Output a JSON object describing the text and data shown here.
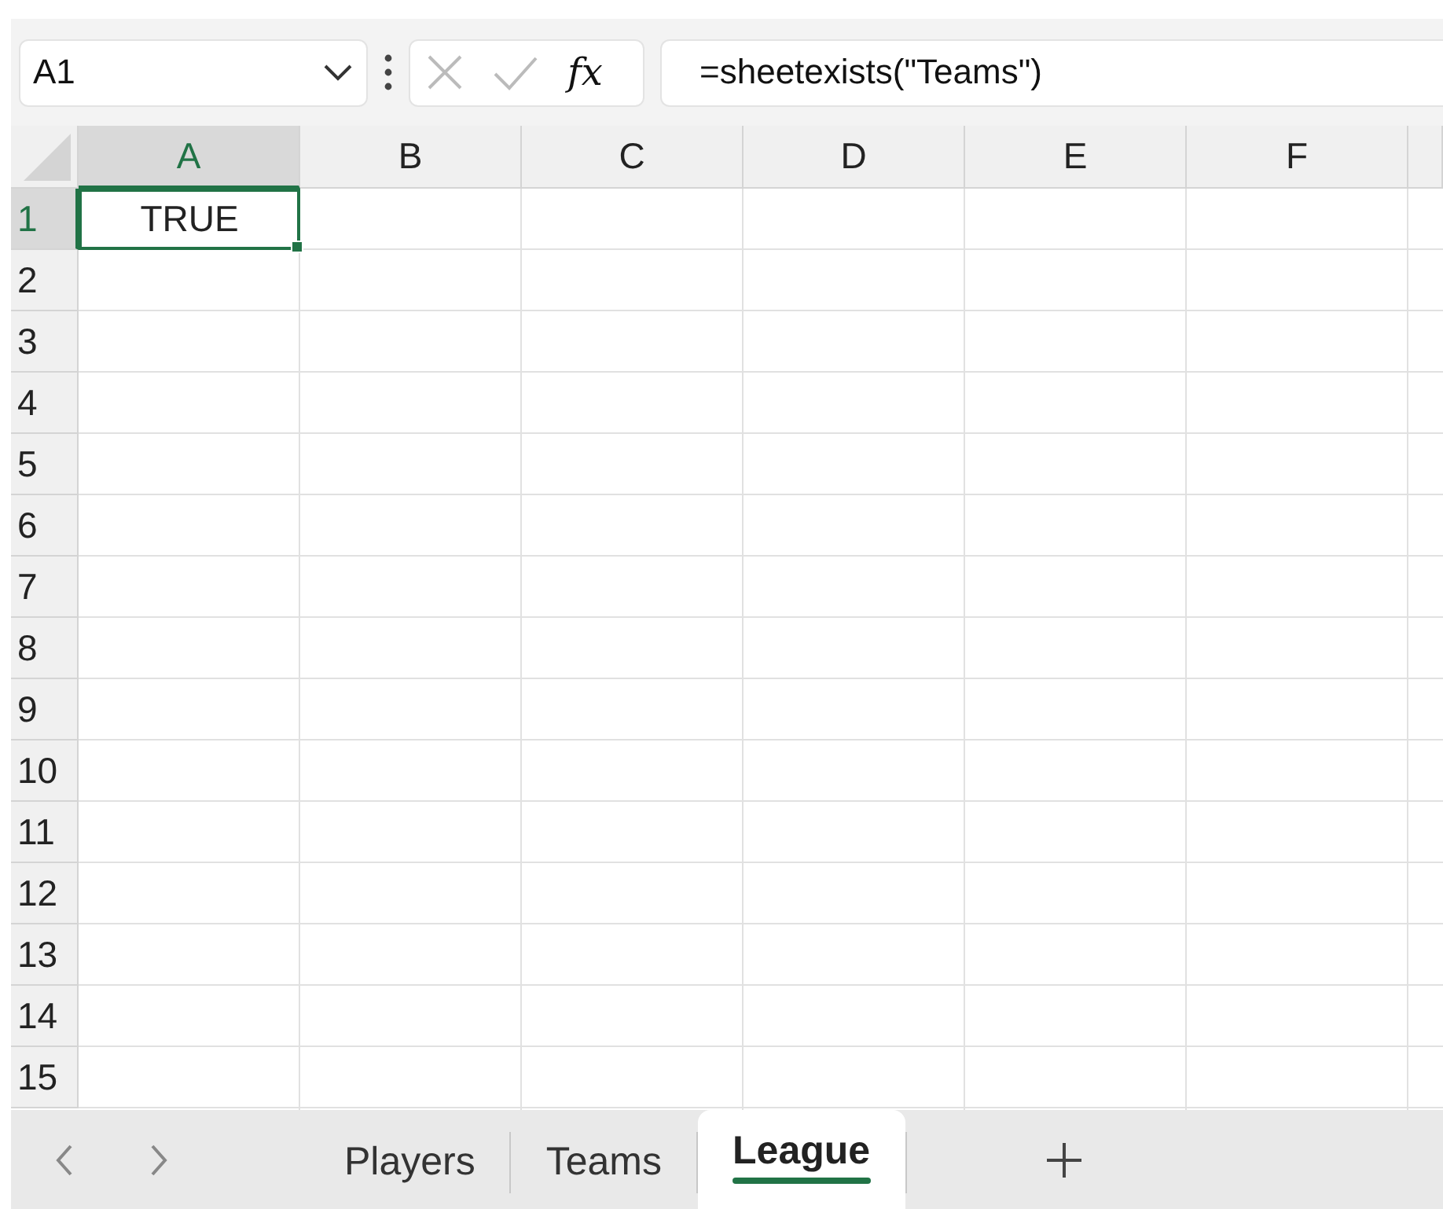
{
  "name_box": {
    "value": "A1"
  },
  "formula_bar": {
    "function_label": "fx",
    "value": "=sheetexists(\"Teams\")"
  },
  "grid": {
    "columns": [
      {
        "label": "A",
        "selected": true
      },
      {
        "label": "B",
        "selected": false
      },
      {
        "label": "C",
        "selected": false
      },
      {
        "label": "D",
        "selected": false
      },
      {
        "label": "E",
        "selected": false
      },
      {
        "label": "F",
        "selected": false
      }
    ],
    "rows": [
      {
        "label": "1",
        "selected": true,
        "cells": [
          {
            "value": "TRUE",
            "selected": true
          }
        ]
      },
      {
        "label": "2",
        "selected": false
      },
      {
        "label": "3",
        "selected": false
      },
      {
        "label": "4",
        "selected": false
      },
      {
        "label": "5",
        "selected": false
      },
      {
        "label": "6",
        "selected": false
      },
      {
        "label": "7",
        "selected": false
      },
      {
        "label": "8",
        "selected": false
      },
      {
        "label": "9",
        "selected": false
      },
      {
        "label": "10",
        "selected": false
      },
      {
        "label": "11",
        "selected": false
      },
      {
        "label": "12",
        "selected": false
      },
      {
        "label": "13",
        "selected": false
      },
      {
        "label": "14",
        "selected": false
      },
      {
        "label": "15",
        "selected": false
      }
    ]
  },
  "sheet_tabs": [
    {
      "label": "Players",
      "selected": false
    },
    {
      "label": "Teams",
      "selected": false
    },
    {
      "label": "League",
      "selected": true
    }
  ]
}
